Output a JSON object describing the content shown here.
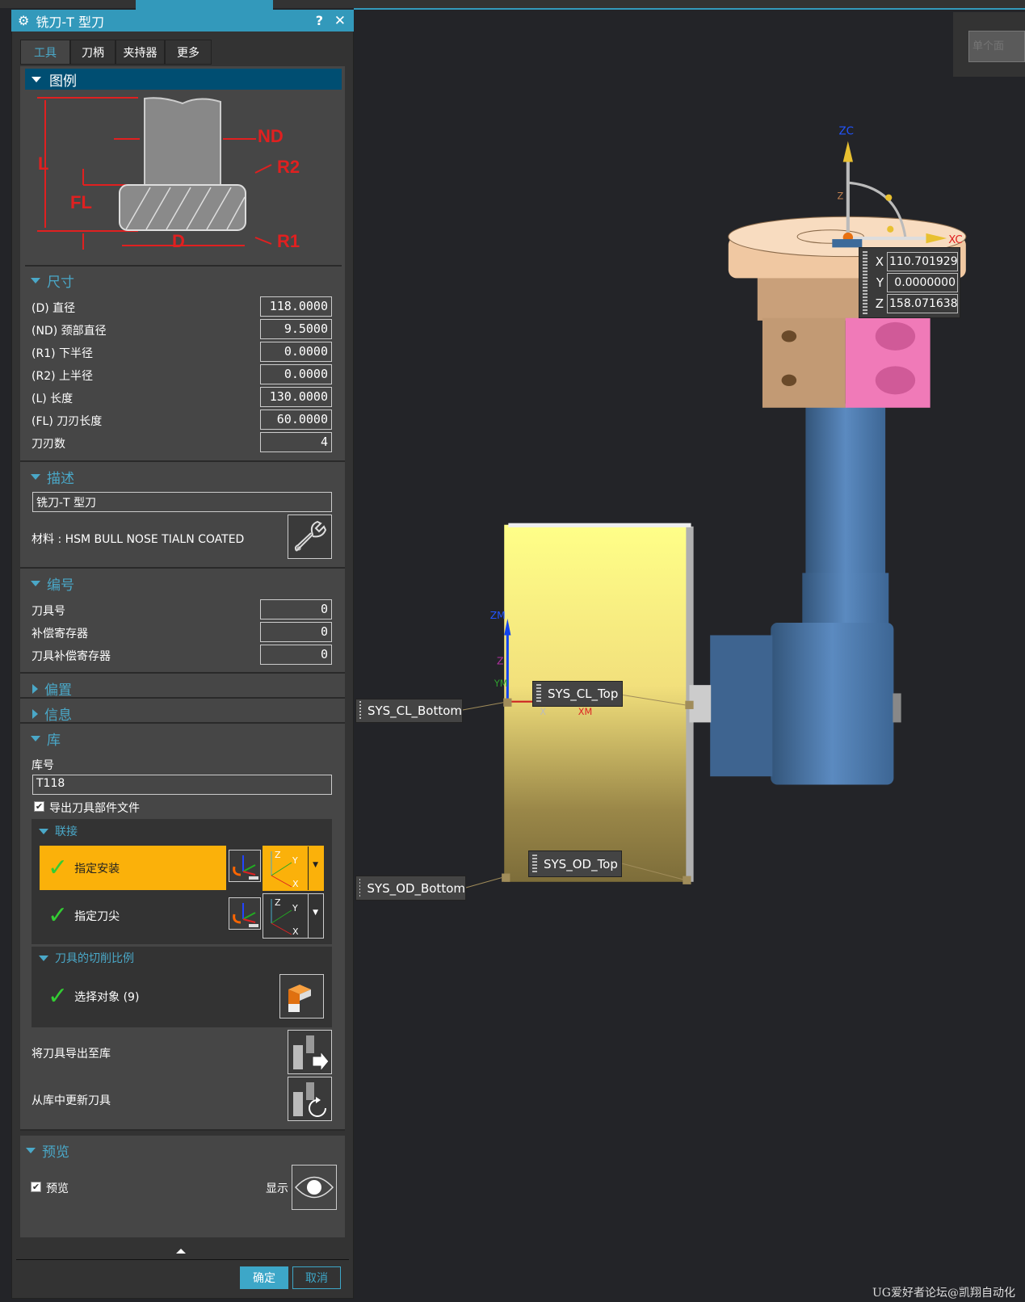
{
  "dialog": {
    "title": "铣刀-T 型刀",
    "help": "?",
    "close": "✕",
    "tabs": [
      "工具",
      "刀柄",
      "夹持器",
      "更多"
    ],
    "legend": {
      "label": "图例",
      "marks": [
        "ND",
        "R2",
        "L",
        "FL",
        "D",
        "R1"
      ]
    },
    "dimensions": {
      "label": "尺寸",
      "rows": [
        {
          "label": "(D) 直径",
          "value": "118.0000"
        },
        {
          "label": "(ND) 颈部直径",
          "value": "9.5000"
        },
        {
          "label": "(R1) 下半径",
          "value": "0.0000"
        },
        {
          "label": "(R2) 上半径",
          "value": "0.0000"
        },
        {
          "label": "(L) 长度",
          "value": "130.0000"
        },
        {
          "label": "(FL) 刀刃长度",
          "value": "60.0000"
        },
        {
          "label": "刀刃数",
          "value": "4"
        }
      ]
    },
    "description": {
      "label": "描述",
      "value": "铣刀-T 型刀",
      "material": "材料 : HSM BULL NOSE TIALN COATED"
    },
    "numbering": {
      "label": "编号",
      "rows": [
        {
          "label": "刀具号",
          "value": "0"
        },
        {
          "label": "补偿寄存器",
          "value": "0"
        },
        {
          "label": "刀具补偿寄存器",
          "value": "0"
        }
      ]
    },
    "offset": {
      "label": "偏置"
    },
    "info": {
      "label": "信息"
    },
    "library": {
      "label": "库",
      "lib_no_label": "库号",
      "lib_no": "T118",
      "export_part": "导出刀具部件文件",
      "export_part_checked": true,
      "mount": {
        "label": "联接",
        "specify_mount": "指定安装",
        "specify_tip": "指定刀尖",
        "csys_axes": [
          "Z",
          "Y",
          "X"
        ]
      },
      "cut_ratio": {
        "label": "刀具的切削比例",
        "select": "选择对象 (9)"
      },
      "export_to_lib": "将刀具导出至库",
      "update_from_lib": "从库中更新刀具"
    },
    "preview": {
      "label": "预览",
      "checkbox": "预览",
      "checked": true,
      "show": "显示"
    },
    "ok": "确定",
    "cancel": "取消"
  },
  "viewport": {
    "filter_placeholder": "单个面",
    "axes": {
      "zc": "ZC",
      "xc": "XC",
      "z": "Z",
      "zm": "ZM",
      "ym": "YM",
      "xm": "XM",
      "x": "X"
    },
    "coords": [
      {
        "axis": "X",
        "value": "110.701929"
      },
      {
        "axis": "Y",
        "value": "0.0000000"
      },
      {
        "axis": "Z",
        "value": "158.071638"
      }
    ],
    "labels": {
      "cl_bottom": "SYS_CL_Bottom",
      "cl_top": "SYS_CL_Top",
      "od_top": "SYS_OD_Top",
      "od_bottom": "SYS_OD_Bottom"
    },
    "watermark": "UG爱好者论坛@凯翔自动化"
  },
  "colors": {
    "accent": "#3399bb",
    "highlight": "#fbb10a",
    "legend_header": "#004e72"
  }
}
